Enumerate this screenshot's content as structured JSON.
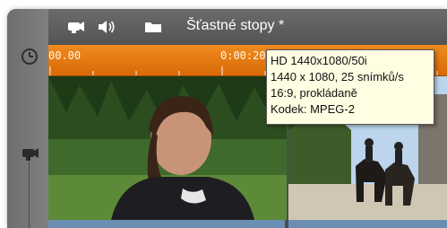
{
  "window": {
    "title": "Šťastné stopy *"
  },
  "toolbar": {
    "icons": [
      "camera-icon",
      "speaker-icon",
      "folder-icon"
    ]
  },
  "rail": {
    "icons": [
      "clock-icon",
      "camera-icon"
    ]
  },
  "ruler": {
    "start_timecode": "00.00",
    "mid_timecode": "0:00:20",
    "color": "#e97a12"
  },
  "tooltip": {
    "lines": [
      "HD 1440x1080/50i",
      "1440 x 1080, 25 snímků/s",
      "16:9, prokládaně",
      "Kodek: MPEG-2"
    ]
  },
  "clips": [
    {
      "name": "clip-woman-forest"
    },
    {
      "name": "clip-riders-castle"
    }
  ],
  "colors": {
    "titlebar": "#5f5f5f",
    "tooltip_bg": "#fffee3",
    "clip_strip": "#6b8fb3"
  }
}
